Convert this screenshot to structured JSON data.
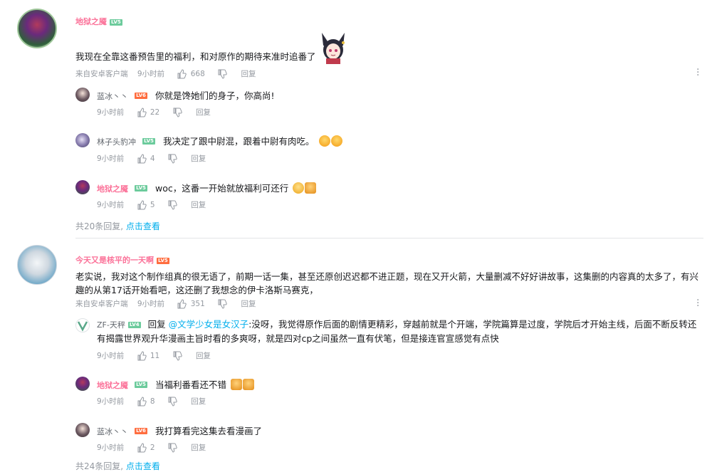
{
  "comments": [
    {
      "user": "地狱之魇",
      "level": "LV5",
      "text": "我现在全靠这番预告里的福利，和对原作的期待来准时追番了",
      "source": "来自安卓客户端",
      "time": "9小时前",
      "likes": "668",
      "reply_label": "回复",
      "replies": [
        {
          "user": "蓝冰丶丶",
          "level": "LV6",
          "text": "你就是馋她们的身子，你高尚!",
          "time": "9小时前",
          "likes": "22",
          "reply_label": "回复"
        },
        {
          "user": "林子头豹冲",
          "level": "LV5",
          "text": "我决定了跟中尉混，跟着中尉有肉吃。",
          "time": "9小时前",
          "likes": "4",
          "reply_label": "回复"
        },
        {
          "user": "地狱之魇",
          "level": "LV5",
          "text": "woc，这番一开始就放福利可还行",
          "time": "9小时前",
          "likes": "5",
          "reply_label": "回复"
        }
      ],
      "reply_count_text": "共20条回复,",
      "view_more": "点击查看"
    },
    {
      "user": "今天又是核平的一天啊",
      "level": "LV5",
      "text": "老实说，我对这个制作组真的很无语了，前期一话一集，甚至还原创迟迟都不进正题，现在又开火箭，大量删减不好好讲故事，这集删的内容真的太多了，有兴趣的从第17话开始看吧，这还删了我想念的伊卡洛斯马赛克，",
      "source": "来自安卓客户端",
      "time": "9小时前",
      "likes": "351",
      "reply_label": "回复",
      "replies": [
        {
          "user": "ZF-天秤",
          "level": "LV4",
          "reply_prefix": "回复",
          "mention": "@文学少女是女汉子",
          "text": ":没呀，我觉得原作后面的剧情更精彩，穿越前就是个开端，学院篇算是过度，学院后才开始主线，后面不断反转还有揭露世界观升华漫画主旨时看的多爽呀，就是四对cp之间虽然一直有伏笔，但是接连官宣感觉有点快",
          "time": "9小时前",
          "likes": "11",
          "reply_label": "回复"
        },
        {
          "user": "地狱之魇",
          "level": "LV5",
          "text": "当福利番看还不错",
          "time": "9小时前",
          "likes": "8",
          "reply_label": "回复"
        },
        {
          "user": "蓝冰丶丶",
          "level": "LV6",
          "text": "我打算看完这集去看漫画了",
          "time": "9小时前",
          "likes": "2",
          "reply_label": "回复"
        }
      ],
      "reply_count_text": "共24条回复,",
      "view_more": "点击查看"
    }
  ],
  "colors": {
    "pink": "#fb7299",
    "blue": "#00aeec",
    "grey": "#9499a0",
    "divider": "#e3e5e7"
  }
}
